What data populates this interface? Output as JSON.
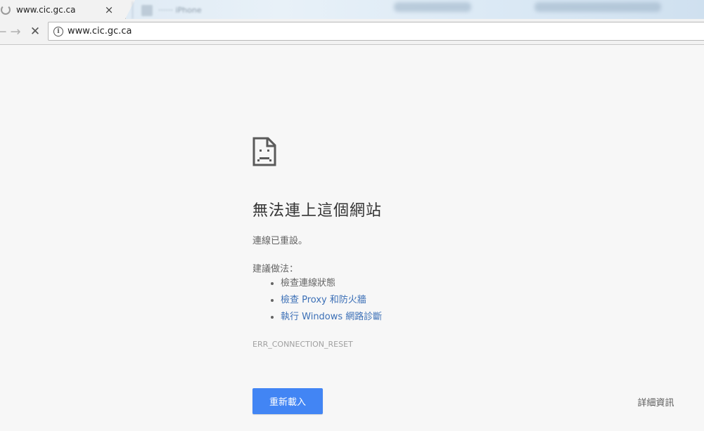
{
  "browser": {
    "active_tab": {
      "title": "www.cic.gc.ca",
      "close_glyph": "×"
    },
    "inactive_tab": {
      "title": "······ iPhone"
    },
    "nav": {
      "back_glyph": "←",
      "forward_glyph": "→",
      "stop_glyph": "✕"
    },
    "omnibox": {
      "info_glyph": "i",
      "url": "www.cic.gc.ca"
    }
  },
  "error_page": {
    "icon": "sad-page-icon",
    "title": "無法連上這個網站",
    "message": "連線已重設。",
    "suggestions_heading": "建議做法：",
    "suggestions": [
      {
        "label": "檢查連線狀態"
      },
      {
        "label": "檢查 Proxy 和防火牆"
      },
      {
        "label": "執行 Windows 網路診斷"
      }
    ],
    "error_code": "ERR_CONNECTION_RESET",
    "reload_label": "重新載入",
    "details_label": "詳細資訊"
  },
  "colors": {
    "link": "#3b6fb6",
    "button": "#4285f4",
    "background": "#f7f7f7"
  }
}
